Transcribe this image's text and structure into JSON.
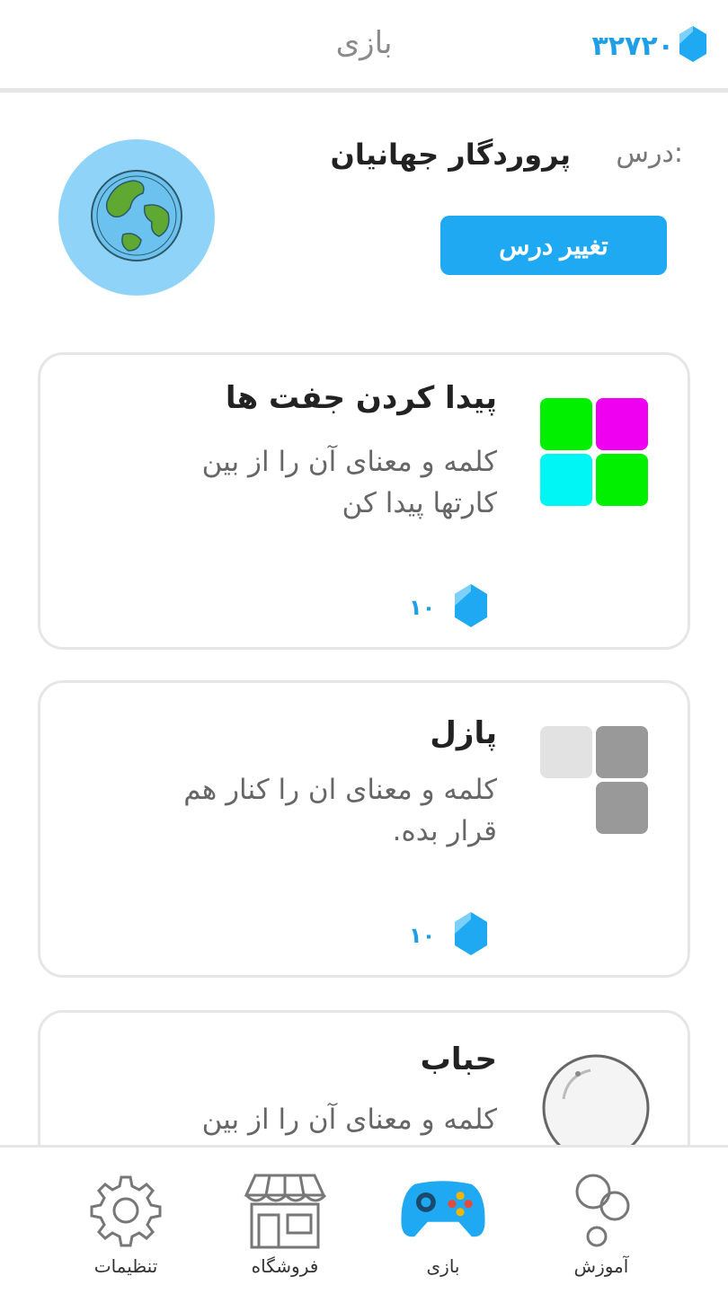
{
  "topbar": {
    "title": "بازی",
    "gem_count": "۳۲۷۲۰",
    "gem_icon": "gem-icon",
    "accent_color": "#1f9fe8"
  },
  "lesson": {
    "label": "درس:",
    "name": "پروردگار جهانیان",
    "change_button_label": "تغییر درس",
    "avatar_icon": "globe-icon"
  },
  "games": [
    {
      "title": "پیدا کردن جفت ها",
      "description_lines": [
        "کلمه و معنای آن را از بین",
        "کارتها پیدا کن"
      ],
      "cost": "۱۰",
      "icon": "matching-cards-icon"
    },
    {
      "title": "پازل",
      "description_lines": [
        "کلمه و معنای ان را کنار هم",
        "قرار بده."
      ],
      "cost": "۱۰",
      "icon": "puzzle-icon"
    },
    {
      "title": "حباب",
      "description_lines": [
        "کلمه و معنای آن را از بین"
      ],
      "icon": "bubble-icon"
    }
  ],
  "bottom_nav": {
    "items": [
      {
        "label": "آموزش",
        "icon": "learning-icon"
      },
      {
        "label": "بازی",
        "icon": "gamepad-icon",
        "active": true
      },
      {
        "label": "فروشگاه",
        "icon": "store-icon"
      },
      {
        "label": "تنظیمات",
        "icon": "gear-icon"
      }
    ]
  }
}
